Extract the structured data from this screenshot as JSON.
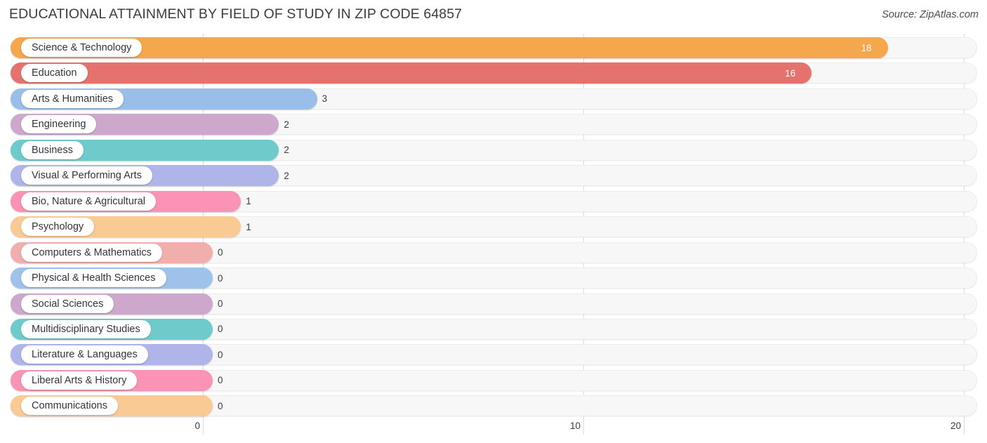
{
  "header": {
    "title": "EDUCATIONAL ATTAINMENT BY FIELD OF STUDY IN ZIP CODE 64857",
    "source": "Source: ZipAtlas.com"
  },
  "chart_data": {
    "type": "bar",
    "orientation": "horizontal",
    "title": "EDUCATIONAL ATTAINMENT BY FIELD OF STUDY IN ZIP CODE 64857",
    "subtitle": "Source: ZipAtlas.com",
    "xlabel": "",
    "ylabel": "",
    "xlim": [
      0,
      20
    ],
    "xticks": [
      0,
      10,
      20
    ],
    "xtick_labels": [
      "0",
      "10",
      "20"
    ],
    "grid": true,
    "legend": false,
    "categories": [
      "Science & Technology",
      "Education",
      "Arts & Humanities",
      "Engineering",
      "Business",
      "Visual & Performing Arts",
      "Bio, Nature & Agricultural",
      "Psychology",
      "Computers & Mathematics",
      "Physical & Health Sciences",
      "Social Sciences",
      "Multidisciplinary Studies",
      "Literature & Languages",
      "Liberal Arts & History",
      "Communications"
    ],
    "values": [
      18,
      16,
      3,
      2,
      2,
      2,
      1,
      1,
      0,
      0,
      0,
      0,
      0,
      0,
      0
    ],
    "value_labels": [
      "18",
      "16",
      "3",
      "2",
      "2",
      "2",
      "1",
      "1",
      "0",
      "0",
      "0",
      "0",
      "0",
      "0",
      "0"
    ],
    "colors": [
      "#f5a74e",
      "#e5726e",
      "#99bee8",
      "#cda8cc",
      "#6fcbcb",
      "#afb5e8",
      "#fa93b5",
      "#f9ca94",
      "#f0aeac",
      "#9ec2ea",
      "#cda8cc",
      "#6fcbcb",
      "#afb5e8",
      "#fa93b5",
      "#f9ca94"
    ]
  }
}
